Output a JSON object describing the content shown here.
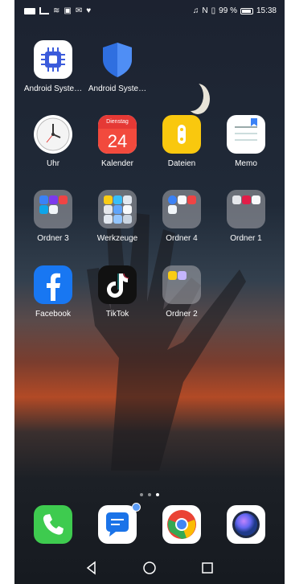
{
  "status_bar": {
    "battery_text": "99 %",
    "time": "15:38"
  },
  "apps_row1": [
    {
      "label": "Android Syste…",
      "icon": "android-system-chip-icon"
    },
    {
      "label": "Android Syste…",
      "icon": "android-system-shield-icon"
    }
  ],
  "apps_row2": [
    {
      "label": "Uhr",
      "icon": "clock-icon"
    },
    {
      "label": "Kalender",
      "icon": "calendar-icon",
      "calendar_day": "Dienstag",
      "calendar_date": "24"
    },
    {
      "label": "Dateien",
      "icon": "files-icon"
    },
    {
      "label": "Memo",
      "icon": "memo-icon"
    }
  ],
  "apps_row3": [
    {
      "label": "Ordner 3",
      "icon": "folder-icon"
    },
    {
      "label": "Werkzeuge",
      "icon": "folder-icon"
    },
    {
      "label": "Ordner 4",
      "icon": "folder-icon"
    },
    {
      "label": "Ordner 1",
      "icon": "folder-icon"
    }
  ],
  "apps_row4": [
    {
      "label": "Facebook",
      "icon": "facebook-icon"
    },
    {
      "label": "TikTok",
      "icon": "tiktok-icon"
    },
    {
      "label": "Ordner 2",
      "icon": "folder-icon"
    }
  ],
  "page_indicator": {
    "pages": 3,
    "active_index": 2
  },
  "dock": [
    {
      "icon": "phone-icon"
    },
    {
      "icon": "messages-icon"
    },
    {
      "icon": "chrome-icon"
    },
    {
      "icon": "camera-icon"
    }
  ],
  "colors": {
    "facebook": "#1877f2",
    "calendar_red": "#e53935",
    "files_yellow": "#f9c80e",
    "phone_green": "#3ecb4f",
    "messages_blue": "#1a73e8"
  }
}
